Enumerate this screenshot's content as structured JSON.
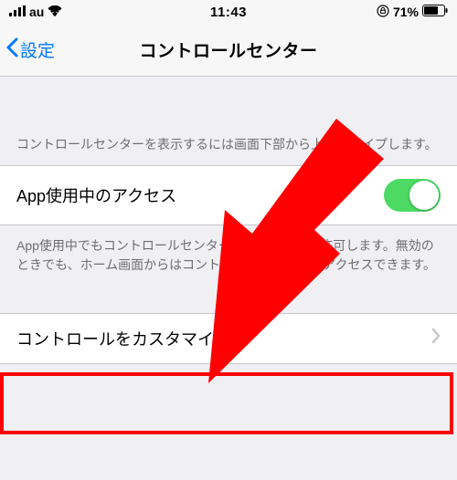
{
  "statusbar": {
    "carrier": "au",
    "time": "11:43",
    "battery_pct": "71%"
  },
  "nav": {
    "back_label": "設定",
    "title": "コントロールセンター"
  },
  "section1": {
    "footer": "コントロールセンターを表示するには画面下部から上にスワイプします。"
  },
  "toggle_row": {
    "label": "App使用中のアクセス",
    "on": true
  },
  "section2": {
    "footer": "App使用中でもコントロールセンターへのアクセスを許可します。無効のときでも、ホーム画面からはコントロールセンターにアクセスできます。"
  },
  "customize_row": {
    "label": "コントロールをカスタマイズ"
  }
}
